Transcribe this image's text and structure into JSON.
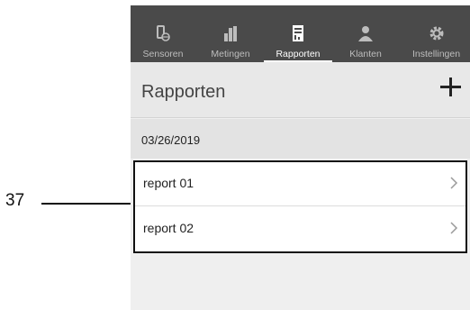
{
  "callout": {
    "label": "37"
  },
  "nav": {
    "items": [
      {
        "label": "Sensoren",
        "icon": "sensor-icon"
      },
      {
        "label": "Metingen",
        "icon": "bar-chart-icon"
      },
      {
        "label": "Rapporten",
        "icon": "report-icon"
      },
      {
        "label": "Klanten",
        "icon": "customer-icon"
      },
      {
        "label": "Instellingen",
        "icon": "gear-icon"
      }
    ],
    "active": "Rapporten"
  },
  "header": {
    "title": "Rapporten",
    "add_icon": "plus-icon"
  },
  "section": {
    "date": "03/26/2019"
  },
  "reports": [
    {
      "label": "report 01"
    },
    {
      "label": "report 02"
    }
  ],
  "colors": {
    "nav_bg": "#4a4a4a",
    "page_bg": "#efefef",
    "header_bg": "#e8e8e8"
  }
}
